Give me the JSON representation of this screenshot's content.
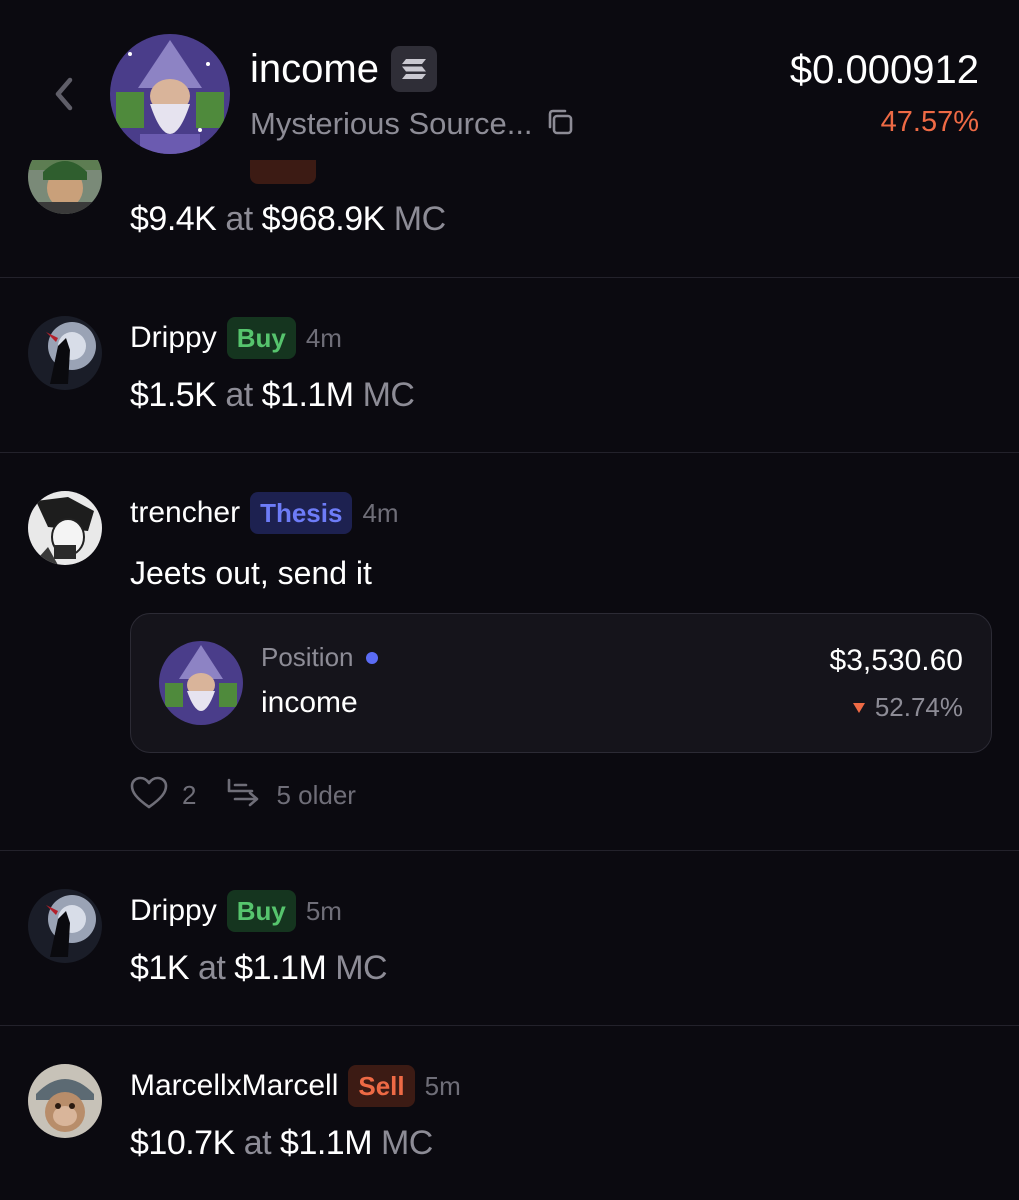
{
  "header": {
    "back_icon": "chevron-left-icon",
    "token_name": "income",
    "chain_icon": "solana-icon",
    "token_subtitle": "Mysterious Source...",
    "copy_icon": "copy-icon",
    "price": "$0.000912",
    "change": "47.57%",
    "change_color": "#ee6a45"
  },
  "feed": {
    "posts": [
      {
        "trade_amount": "$9.4K",
        "at": "at",
        "mc_value": "$968.9K",
        "mc": "MC"
      },
      {
        "name": "Drippy",
        "badge": "Buy",
        "time": "4m",
        "trade_amount": "$1.5K",
        "at": "at",
        "mc_value": "$1.1M",
        "mc": "MC"
      },
      {
        "name": "trencher",
        "badge": "Thesis",
        "time": "4m",
        "text": "Jeets out, send it",
        "position": {
          "label": "Position",
          "token": "income",
          "value": "$3,530.60",
          "change": "52.74%"
        },
        "likes": "2",
        "older": "5 older"
      },
      {
        "name": "Drippy",
        "badge": "Buy",
        "time": "5m",
        "trade_amount": "$1K",
        "at": "at",
        "mc_value": "$1.1M",
        "mc": "MC"
      },
      {
        "name": "MarcellxMarcell",
        "badge": "Sell",
        "time": "5m",
        "trade_amount": "$10.7K",
        "at": "at",
        "mc_value": "$1.1M",
        "mc": "MC"
      }
    ]
  },
  "colors": {
    "background": "#0b0a10",
    "buy": "#56c46d",
    "sell": "#ee6a45",
    "thesis": "#6d7cf7",
    "muted": "#8d8c96"
  }
}
